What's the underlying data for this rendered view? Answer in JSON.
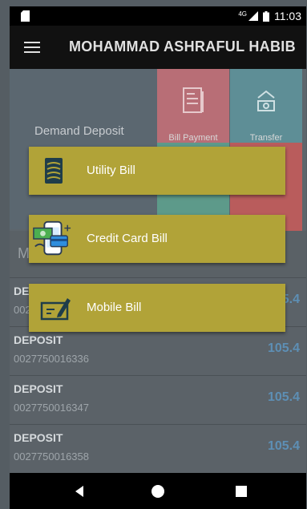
{
  "status_bar": {
    "network": "4G",
    "time": "11:03"
  },
  "app_bar": {
    "title": "MOHAMMAD ASHRAFUL HABIB",
    "menu_icon": "hamburger-menu-icon"
  },
  "dashboard": {
    "left_card_label": "Demand Deposit",
    "tiles": [
      {
        "label": "Bill Payment",
        "icon": "bill-icon",
        "color": "#b86e76"
      },
      {
        "label": "Transfer",
        "icon": "transfer-icon",
        "color": "#5e8e96"
      }
    ],
    "section_letter": "M"
  },
  "accounts": [
    {
      "title": "DEPOSIT",
      "number": "0027750016336",
      "amount": "105.4"
    },
    {
      "title": "DEPOSIT",
      "number": "0027750016336",
      "amount": "105.4"
    },
    {
      "title": "DEPOSIT",
      "number": "0027750016347",
      "amount": "105.4"
    },
    {
      "title": "DEPOSIT",
      "number": "0027750016358",
      "amount": "105.4"
    }
  ],
  "partial_row": {
    "title": "DE",
    "number": "002",
    "amount": "5.4"
  },
  "popup_menu": {
    "color": "#b1a338",
    "items": [
      {
        "label": "Utility Bill",
        "icon": "utility-bill-icon"
      },
      {
        "label": "Credit Card Bill",
        "icon": "credit-card-icon"
      },
      {
        "label": "Mobile Bill",
        "icon": "mobile-bill-icon"
      }
    ]
  },
  "nav_bar": {
    "buttons": [
      "back-icon",
      "home-icon",
      "recent-apps-icon"
    ]
  }
}
